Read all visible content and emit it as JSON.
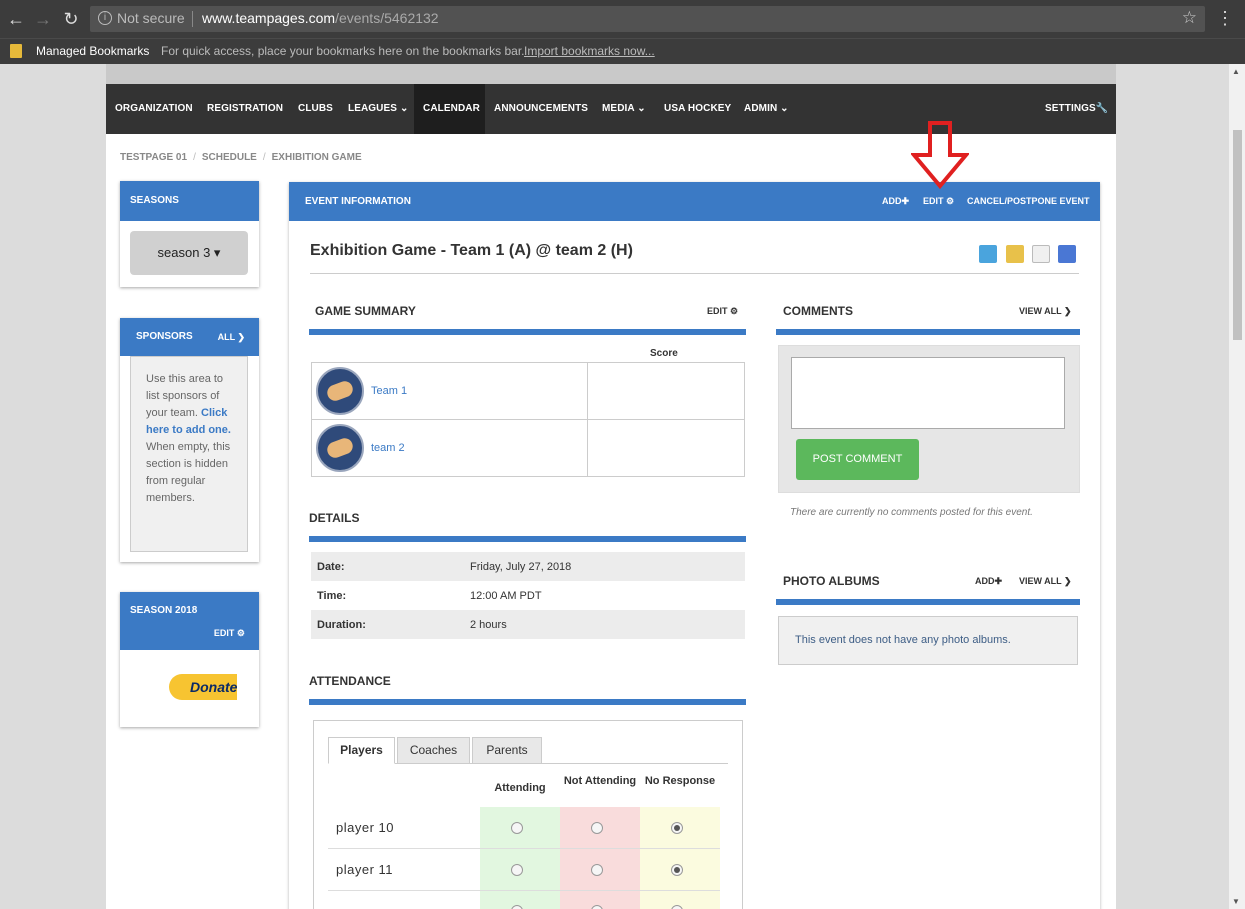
{
  "browser": {
    "security_label": "Not secure",
    "url_host": "www.teampages.com",
    "url_path": "/events/5462132",
    "bookmarks_folder": "Managed Bookmarks",
    "bookmarks_hint": "For quick access, place your bookmarks here on the bookmarks bar.",
    "import_link": "Import bookmarks now..."
  },
  "nav": {
    "items": [
      "ORGANIZATION",
      "REGISTRATION",
      "CLUBS",
      "LEAGUES",
      "CALENDAR",
      "ANNOUNCEMENTS",
      "MEDIA",
      "USA HOCKEY",
      "ADMIN"
    ],
    "active": "CALENDAR",
    "settings": "SETTINGS"
  },
  "breadcrumb": [
    "TESTPAGE 01",
    "SCHEDULE",
    "EXHIBITION GAME"
  ],
  "sidebar": {
    "seasons_title": "SEASONS",
    "season_selected": "season 3",
    "sponsors_title": "SPONSORS",
    "sponsors_all": "ALL",
    "sponsors_text_1": "Use this area to list sponsors of your team.",
    "sponsors_link": "Click here to add one.",
    "sponsors_text_2": "When empty, this section is hidden from regular members.",
    "season2018_title": "SEASON 2018",
    "season2018_edit": "EDIT",
    "donate_label": "Donate"
  },
  "event": {
    "header": "EVENT INFORMATION",
    "add": "ADD",
    "edit": "EDIT",
    "cancel": "CANCEL/POSTPONE EVENT",
    "title": "Exhibition Game - Team 1 (A) @ team 2 (H)"
  },
  "game_summary": {
    "title": "GAME SUMMARY",
    "edit": "EDIT",
    "score_label": "Score",
    "teams": [
      "Team 1",
      "team 2"
    ]
  },
  "details": {
    "title": "DETAILS",
    "rows": [
      {
        "label": "Date:",
        "value": "Friday, July 27, 2018"
      },
      {
        "label": "Time:",
        "value": "12:00 AM PDT"
      },
      {
        "label": "Duration:",
        "value": "2 hours"
      }
    ]
  },
  "attendance": {
    "title": "ATTENDANCE",
    "tabs": [
      "Players",
      "Coaches",
      "Parents"
    ],
    "columns": [
      "Attending",
      "Not Attending",
      "No Response"
    ],
    "players": [
      {
        "name": "player 10",
        "response": "No Response"
      },
      {
        "name": "player 11",
        "response": "No Response"
      }
    ]
  },
  "comments": {
    "title": "COMMENTS",
    "view_all": "VIEW ALL",
    "post_button": "POST COMMENT",
    "empty_text": "There are currently no comments posted for this event."
  },
  "photo_albums": {
    "title": "PHOTO ALBUMS",
    "add": "ADD",
    "view_all": "VIEW ALL",
    "empty_text": "This event does not have any photo albums."
  },
  "colors": {
    "brand_blue": "#3b7ac5",
    "nav_dark": "#333333",
    "post_green": "#5cb85c",
    "annotation_red": "#e02020"
  }
}
